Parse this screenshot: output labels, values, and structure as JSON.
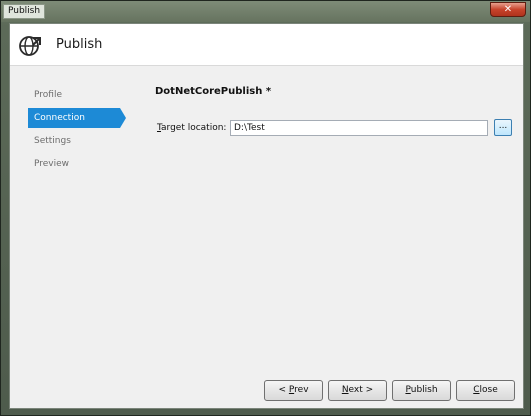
{
  "window": {
    "title": "Publish",
    "close_glyph": "✕"
  },
  "header": {
    "title": "Publish",
    "icon": "globe-publish-icon"
  },
  "nav": {
    "items": [
      {
        "label": "Profile",
        "active": false
      },
      {
        "label": "Connection",
        "active": true
      },
      {
        "label": "Settings",
        "active": false
      },
      {
        "label": "Preview",
        "active": false
      }
    ]
  },
  "main": {
    "profile_name": "DotNetCorePublish *",
    "target_label_mnemonic": "T",
    "target_label_rest": "arget location:",
    "target_value": "D:\\Test",
    "browse_label": "..."
  },
  "footer": {
    "prev_prefix": "< ",
    "prev_mnemonic": "P",
    "prev_rest": "rev",
    "next_mnemonic": "N",
    "next_rest": "ext >",
    "publish_mnemonic": "P",
    "publish_rest": "ublish",
    "close_mnemonic": "C",
    "close_rest": "lose"
  },
  "colors": {
    "accent": "#1d8ad6",
    "browse_border": "#3c7fb1"
  }
}
